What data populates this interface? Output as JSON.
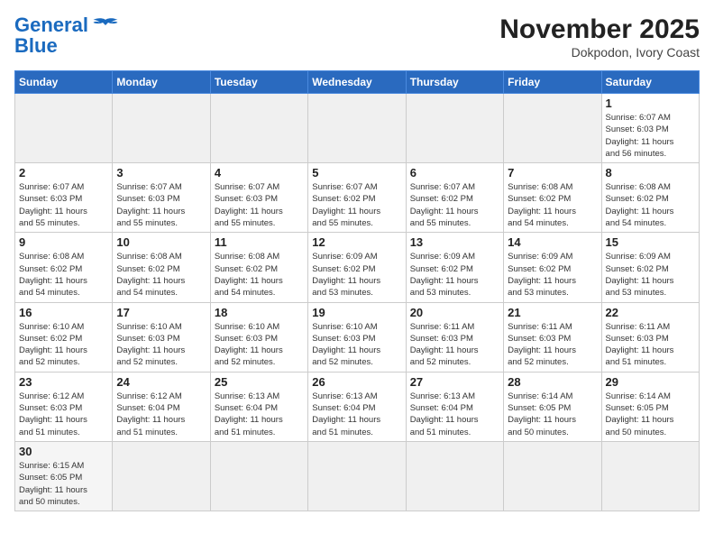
{
  "header": {
    "logo_line1": "General",
    "logo_line2": "Blue",
    "month_year": "November 2025",
    "location": "Dokpodon, Ivory Coast"
  },
  "weekdays": [
    "Sunday",
    "Monday",
    "Tuesday",
    "Wednesday",
    "Thursday",
    "Friday",
    "Saturday"
  ],
  "weeks": [
    [
      {
        "day": "",
        "info": ""
      },
      {
        "day": "",
        "info": ""
      },
      {
        "day": "",
        "info": ""
      },
      {
        "day": "",
        "info": ""
      },
      {
        "day": "",
        "info": ""
      },
      {
        "day": "",
        "info": ""
      },
      {
        "day": "1",
        "info": "Sunrise: 6:07 AM\nSunset: 6:03 PM\nDaylight: 11 hours\nand 56 minutes."
      }
    ],
    [
      {
        "day": "2",
        "info": "Sunrise: 6:07 AM\nSunset: 6:03 PM\nDaylight: 11 hours\nand 55 minutes."
      },
      {
        "day": "3",
        "info": "Sunrise: 6:07 AM\nSunset: 6:03 PM\nDaylight: 11 hours\nand 55 minutes."
      },
      {
        "day": "4",
        "info": "Sunrise: 6:07 AM\nSunset: 6:03 PM\nDaylight: 11 hours\nand 55 minutes."
      },
      {
        "day": "5",
        "info": "Sunrise: 6:07 AM\nSunset: 6:02 PM\nDaylight: 11 hours\nand 55 minutes."
      },
      {
        "day": "6",
        "info": "Sunrise: 6:07 AM\nSunset: 6:02 PM\nDaylight: 11 hours\nand 55 minutes."
      },
      {
        "day": "7",
        "info": "Sunrise: 6:08 AM\nSunset: 6:02 PM\nDaylight: 11 hours\nand 54 minutes."
      },
      {
        "day": "8",
        "info": "Sunrise: 6:08 AM\nSunset: 6:02 PM\nDaylight: 11 hours\nand 54 minutes."
      }
    ],
    [
      {
        "day": "9",
        "info": "Sunrise: 6:08 AM\nSunset: 6:02 PM\nDaylight: 11 hours\nand 54 minutes."
      },
      {
        "day": "10",
        "info": "Sunrise: 6:08 AM\nSunset: 6:02 PM\nDaylight: 11 hours\nand 54 minutes."
      },
      {
        "day": "11",
        "info": "Sunrise: 6:08 AM\nSunset: 6:02 PM\nDaylight: 11 hours\nand 54 minutes."
      },
      {
        "day": "12",
        "info": "Sunrise: 6:09 AM\nSunset: 6:02 PM\nDaylight: 11 hours\nand 53 minutes."
      },
      {
        "day": "13",
        "info": "Sunrise: 6:09 AM\nSunset: 6:02 PM\nDaylight: 11 hours\nand 53 minutes."
      },
      {
        "day": "14",
        "info": "Sunrise: 6:09 AM\nSunset: 6:02 PM\nDaylight: 11 hours\nand 53 minutes."
      },
      {
        "day": "15",
        "info": "Sunrise: 6:09 AM\nSunset: 6:02 PM\nDaylight: 11 hours\nand 53 minutes."
      }
    ],
    [
      {
        "day": "16",
        "info": "Sunrise: 6:10 AM\nSunset: 6:02 PM\nDaylight: 11 hours\nand 52 minutes."
      },
      {
        "day": "17",
        "info": "Sunrise: 6:10 AM\nSunset: 6:03 PM\nDaylight: 11 hours\nand 52 minutes."
      },
      {
        "day": "18",
        "info": "Sunrise: 6:10 AM\nSunset: 6:03 PM\nDaylight: 11 hours\nand 52 minutes."
      },
      {
        "day": "19",
        "info": "Sunrise: 6:10 AM\nSunset: 6:03 PM\nDaylight: 11 hours\nand 52 minutes."
      },
      {
        "day": "20",
        "info": "Sunrise: 6:11 AM\nSunset: 6:03 PM\nDaylight: 11 hours\nand 52 minutes."
      },
      {
        "day": "21",
        "info": "Sunrise: 6:11 AM\nSunset: 6:03 PM\nDaylight: 11 hours\nand 52 minutes."
      },
      {
        "day": "22",
        "info": "Sunrise: 6:11 AM\nSunset: 6:03 PM\nDaylight: 11 hours\nand 51 minutes."
      }
    ],
    [
      {
        "day": "23",
        "info": "Sunrise: 6:12 AM\nSunset: 6:03 PM\nDaylight: 11 hours\nand 51 minutes."
      },
      {
        "day": "24",
        "info": "Sunrise: 6:12 AM\nSunset: 6:04 PM\nDaylight: 11 hours\nand 51 minutes."
      },
      {
        "day": "25",
        "info": "Sunrise: 6:13 AM\nSunset: 6:04 PM\nDaylight: 11 hours\nand 51 minutes."
      },
      {
        "day": "26",
        "info": "Sunrise: 6:13 AM\nSunset: 6:04 PM\nDaylight: 11 hours\nand 51 minutes."
      },
      {
        "day": "27",
        "info": "Sunrise: 6:13 AM\nSunset: 6:04 PM\nDaylight: 11 hours\nand 51 minutes."
      },
      {
        "day": "28",
        "info": "Sunrise: 6:14 AM\nSunset: 6:05 PM\nDaylight: 11 hours\nand 50 minutes."
      },
      {
        "day": "29",
        "info": "Sunrise: 6:14 AM\nSunset: 6:05 PM\nDaylight: 11 hours\nand 50 minutes."
      }
    ],
    [
      {
        "day": "30",
        "info": "Sunrise: 6:15 AM\nSunset: 6:05 PM\nDaylight: 11 hours\nand 50 minutes."
      },
      {
        "day": "",
        "info": ""
      },
      {
        "day": "",
        "info": ""
      },
      {
        "day": "",
        "info": ""
      },
      {
        "day": "",
        "info": ""
      },
      {
        "day": "",
        "info": ""
      },
      {
        "day": "",
        "info": ""
      }
    ]
  ]
}
